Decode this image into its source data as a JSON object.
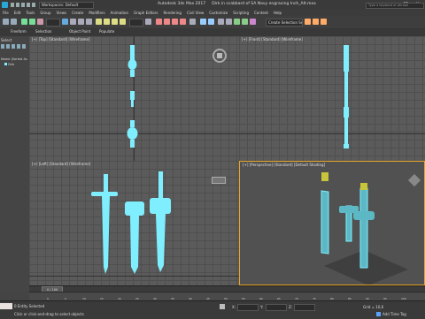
{
  "window": {
    "title": "Autodesk 3ds Max 2017",
    "file": "Dirk in scabbard of SA Navy engraving Inch_Alt.max",
    "search_placeholder": "Type a keyword or phrase",
    "workspace": "Workspaces: Default"
  },
  "menu": [
    "File",
    "Edit",
    "Tools",
    "Group",
    "Views",
    "Create",
    "Modifiers",
    "Animation",
    "Graph Editors",
    "Rendering",
    "Civil View",
    "Customize",
    "Scripting",
    "Content",
    "Help"
  ],
  "toolbar": {
    "selection_set": "Create Selection Se"
  },
  "ribbon": [
    "Freeform",
    "Selection",
    "Object Paint",
    "Populate"
  ],
  "left_panel": {
    "title": "Select",
    "item1": "Name (Sorted As",
    "item2": "Dirk"
  },
  "viewports": {
    "top": "[+] [Top] [Standard] [Wireframe]",
    "front": "[+] [Front] [Standard] [Wireframe]",
    "left": "[+] [Left] [Standard] [Wireframe]",
    "persp": "[+] [Perspective] [Standard] [Default Shading]"
  },
  "timeline": {
    "frame": "0 / 100",
    "ticks": [
      "0",
      "5",
      "10",
      "15",
      "20",
      "25",
      "30",
      "35",
      "40",
      "45",
      "50",
      "55",
      "60",
      "65",
      "70",
      "75",
      "80",
      "85",
      "90",
      "95",
      "100"
    ]
  },
  "status": {
    "selected": "0 Entity Selected",
    "hint": "Click or click-and-drag to select objects",
    "x_label": "X:",
    "y_label": "Y:",
    "z_label": "Z:",
    "grid": "Grid = 10,0",
    "add_time_tag": "Add Time Tag"
  },
  "colors": {
    "wire": "#7fefff",
    "accent": "#e6a323"
  }
}
